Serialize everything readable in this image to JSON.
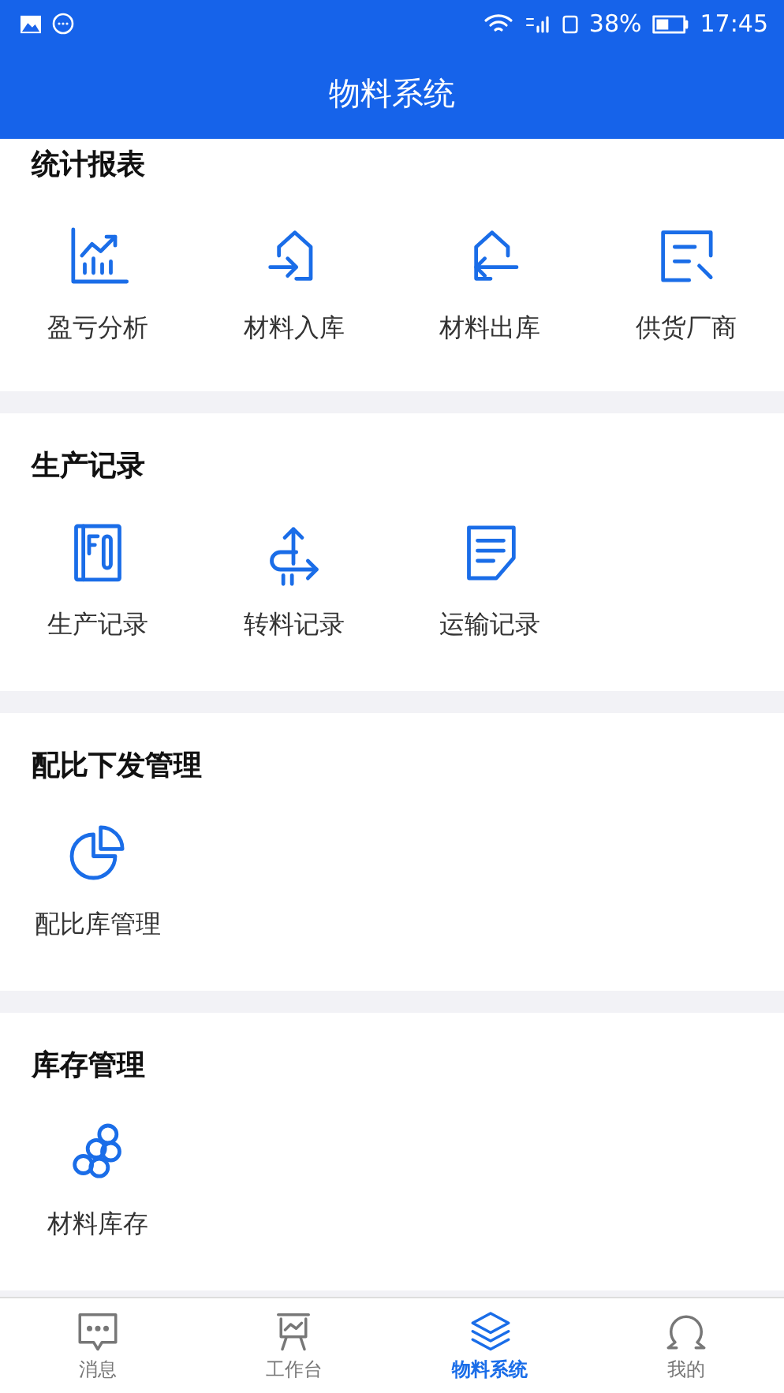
{
  "status_bar": {
    "battery": "38%",
    "time": "17:45"
  },
  "header": {
    "title": "物料系统"
  },
  "sections": [
    {
      "title": "统计报表",
      "items": [
        {
          "label": "盈亏分析"
        },
        {
          "label": "材料入库"
        },
        {
          "label": "材料出库"
        },
        {
          "label": "供货厂商"
        }
      ]
    },
    {
      "title": "生产记录",
      "items": [
        {
          "label": "生产记录"
        },
        {
          "label": "转料记录"
        },
        {
          "label": "运输记录"
        }
      ]
    },
    {
      "title": "配比下发管理",
      "items": [
        {
          "label": "配比库管理"
        }
      ]
    },
    {
      "title": "库存管理",
      "items": [
        {
          "label": "材料库存"
        }
      ]
    }
  ],
  "tab_bar": [
    {
      "label": "消息",
      "selected": false
    },
    {
      "label": "工作台",
      "selected": false
    },
    {
      "label": "物料系统",
      "selected": true
    },
    {
      "label": "我的",
      "selected": false
    }
  ]
}
